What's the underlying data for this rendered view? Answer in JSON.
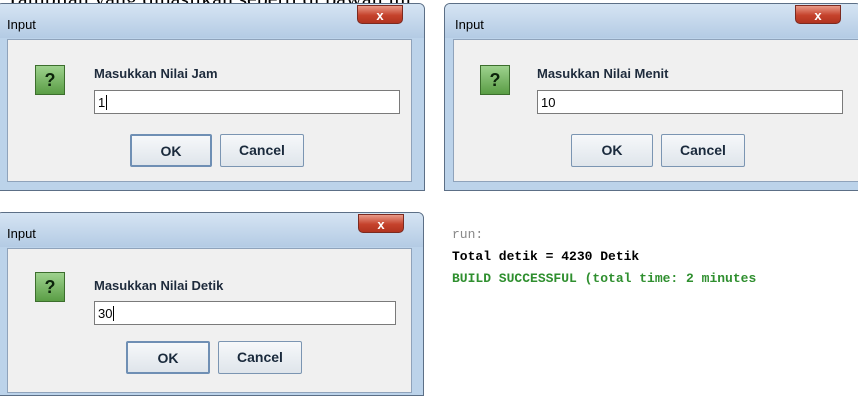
{
  "caption": "Tampilan yang dihasilkan seperti di bawah ini:",
  "dialogs": [
    {
      "title": "Input",
      "prompt": "Masukkan Nilai Jam",
      "value": "1",
      "ok": "OK",
      "cancel": "Cancel"
    },
    {
      "title": "Input",
      "prompt": "Masukkan Nilai Menit",
      "value": "10",
      "ok": "OK",
      "cancel": "Cancel"
    },
    {
      "title": "Input",
      "prompt": "Masukkan Nilai Detik",
      "value": "30",
      "ok": "OK",
      "cancel": "Cancel"
    }
  ],
  "icons": {
    "question": "?",
    "close": "x"
  },
  "console": {
    "run": "run:",
    "output": "Total detik = 4230 Detik",
    "build": "BUILD SUCCESSFUL (total time: 2 minutes"
  },
  "colors": {
    "build_success": "#2f8f2f",
    "question_icon": "#5a9d45",
    "close_button": "#c5422c"
  }
}
